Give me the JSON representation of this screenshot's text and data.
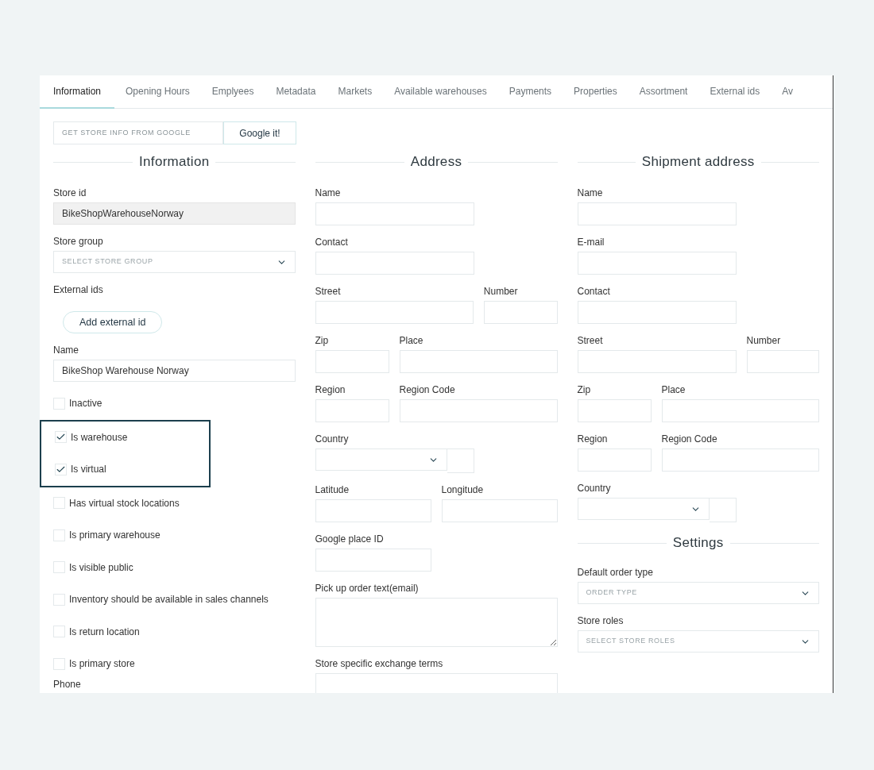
{
  "tabs": [
    {
      "label": "Information",
      "selected": true
    },
    {
      "label": "Opening Hours",
      "selected": false
    },
    {
      "label": "Emplyees",
      "selected": false
    },
    {
      "label": "Metadata",
      "selected": false
    },
    {
      "label": "Markets",
      "selected": false
    },
    {
      "label": "Available warehouses",
      "selected": false
    },
    {
      "label": "Payments",
      "selected": false
    },
    {
      "label": "Properties",
      "selected": false
    },
    {
      "label": "Assortment",
      "selected": false
    },
    {
      "label": "External ids",
      "selected": false
    },
    {
      "label": "Av",
      "selected": false
    }
  ],
  "google": {
    "placeholder": "GET STORE INFO FROM GOOGLE",
    "button": "Google it!"
  },
  "information": {
    "heading": "Information",
    "items": [
      {
        "kind": "readonly",
        "label": "Store id",
        "value": "BikeShopWarehouseNorway"
      },
      {
        "kind": "select",
        "label": "Store group",
        "placeholder": "SELECT STORE GROUP"
      },
      {
        "kind": "button",
        "label": "External ids",
        "button": "Add external id"
      },
      {
        "kind": "input",
        "label": "Name",
        "value": "BikeShop Warehouse Norway"
      },
      {
        "kind": "checkbox",
        "label": "Inactive",
        "checked": false,
        "highlighted": false
      },
      {
        "kind": "checkbox",
        "label": "Is warehouse",
        "checked": true,
        "highlighted": true
      },
      {
        "kind": "checkbox",
        "label": "Is virtual",
        "checked": true,
        "highlighted": true
      },
      {
        "kind": "checkbox",
        "label": "Has virtual stock locations",
        "checked": false,
        "highlighted": false
      },
      {
        "kind": "checkbox",
        "label": "Is primary warehouse",
        "checked": false,
        "highlighted": false
      },
      {
        "kind": "checkbox",
        "label": "Is visible public",
        "checked": false,
        "highlighted": false
      },
      {
        "kind": "checkbox",
        "label": "Inventory should be available in sales channels",
        "checked": false,
        "highlighted": false
      },
      {
        "kind": "checkbox",
        "label": "Is return location",
        "checked": false,
        "highlighted": false
      },
      {
        "kind": "checkbox",
        "label": "Is primary store",
        "checked": false,
        "highlighted": false
      },
      {
        "kind": "label",
        "label": "Phone"
      }
    ]
  },
  "address": {
    "heading": "Address",
    "rows": [
      [
        {
          "kind": "text",
          "label": "Name"
        }
      ],
      [
        {
          "kind": "text",
          "label": "Contact"
        }
      ],
      [
        {
          "kind": "text",
          "label": "Street"
        },
        {
          "kind": "short",
          "label": "Number"
        }
      ],
      [
        {
          "kind": "short",
          "label": "Zip"
        },
        {
          "kind": "fill",
          "label": "Place"
        }
      ],
      [
        {
          "kind": "short",
          "label": "Region"
        },
        {
          "kind": "fill",
          "label": "Region Code"
        }
      ],
      [
        {
          "kind": "country",
          "label": "Country"
        }
      ],
      [
        {
          "kind": "half",
          "label": "Latitude"
        },
        {
          "kind": "fill",
          "label": "Longitude"
        }
      ],
      [
        {
          "kind": "half",
          "label": "Google place ID"
        }
      ],
      [
        {
          "kind": "textarea",
          "label": "Pick up order text(email)"
        }
      ],
      [
        {
          "kind": "textarea",
          "label": "Store specific exchange terms"
        }
      ]
    ]
  },
  "shipment": {
    "heading": "Shipment address",
    "rows": [
      [
        {
          "kind": "text",
          "label": "Name"
        }
      ],
      [
        {
          "kind": "text",
          "label": "E-mail"
        }
      ],
      [
        {
          "kind": "text",
          "label": "Contact"
        }
      ],
      [
        {
          "kind": "text",
          "label": "Street"
        },
        {
          "kind": "fill",
          "label": "Number"
        }
      ],
      [
        {
          "kind": "short",
          "label": "Zip"
        },
        {
          "kind": "fill",
          "label": "Place"
        }
      ],
      [
        {
          "kind": "short",
          "label": "Region"
        },
        {
          "kind": "fill",
          "label": "Region Code"
        }
      ],
      [
        {
          "kind": "country",
          "label": "Country"
        }
      ]
    ]
  },
  "settings": {
    "heading": "Settings",
    "rows": [
      [
        {
          "kind": "select",
          "label": "Default order type",
          "placeholder": "ORDER TYPE"
        }
      ],
      [
        {
          "kind": "select",
          "label": "Store roles",
          "placeholder": "SELECT STORE ROLES"
        }
      ]
    ]
  }
}
